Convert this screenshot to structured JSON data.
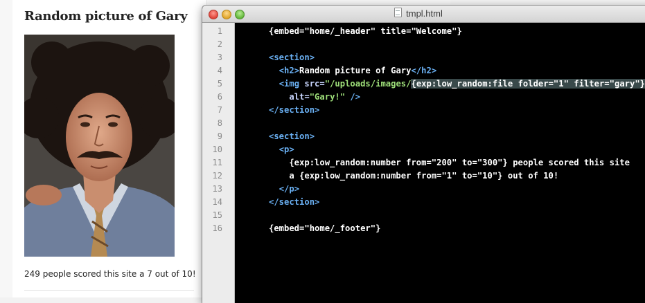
{
  "page": {
    "heading": "Random picture of Gary",
    "image_alt": "Gary!",
    "footer_text": "249 people scored this site a 7 out of 10!"
  },
  "editor": {
    "title": "tmpl.html",
    "line_numbers": [
      "1",
      "2",
      "3",
      "4",
      "5",
      "6",
      "7",
      "8",
      "9",
      "10",
      "11",
      "12",
      "13",
      "14",
      "15",
      "16"
    ],
    "lines": [
      {
        "parts": [
          {
            "t": "plain",
            "v": "{embed=\"home/_header\" title=\"Welcome\"}"
          }
        ]
      },
      {
        "parts": []
      },
      {
        "parts": [
          {
            "t": "tag",
            "v": "<section>"
          }
        ]
      },
      {
        "parts": [
          {
            "t": "plain",
            "v": "  "
          },
          {
            "t": "tag",
            "v": "<h2>"
          },
          {
            "t": "plain",
            "v": "Random picture of Gary"
          },
          {
            "t": "tag",
            "v": "</h2>"
          }
        ]
      },
      {
        "parts": [
          {
            "t": "plain",
            "v": "  "
          },
          {
            "t": "tag",
            "v": "<img "
          },
          {
            "t": "attr",
            "v": "src="
          },
          {
            "t": "str",
            "v": "\"/uploads/images/"
          },
          {
            "t": "hl",
            "v": "{exp:low_random:file folder=\"1\" filter=\"gary\"}"
          },
          {
            "t": "str",
            "v": "\""
          }
        ]
      },
      {
        "parts": [
          {
            "t": "plain",
            "v": "    "
          },
          {
            "t": "attr",
            "v": "alt="
          },
          {
            "t": "str",
            "v": "\"Gary!\""
          },
          {
            "t": "tag",
            "v": " />"
          }
        ]
      },
      {
        "parts": [
          {
            "t": "tag",
            "v": "</section>"
          }
        ]
      },
      {
        "parts": []
      },
      {
        "parts": [
          {
            "t": "tag",
            "v": "<section>"
          }
        ]
      },
      {
        "parts": [
          {
            "t": "plain",
            "v": "  "
          },
          {
            "t": "tag",
            "v": "<p>"
          }
        ]
      },
      {
        "parts": [
          {
            "t": "plain",
            "v": "    {exp:low_random:number from=\"200\" to=\"300\"} people scored this site"
          }
        ]
      },
      {
        "parts": [
          {
            "t": "plain",
            "v": "    a {exp:low_random:number from=\"1\" to=\"10\"} out of 10!"
          }
        ]
      },
      {
        "parts": [
          {
            "t": "plain",
            "v": "  "
          },
          {
            "t": "tag",
            "v": "</p>"
          }
        ]
      },
      {
        "parts": [
          {
            "t": "tag",
            "v": "</section>"
          }
        ]
      },
      {
        "parts": []
      },
      {
        "parts": [
          {
            "t": "plain",
            "v": "{embed=\"home/_footer\"}"
          }
        ]
      }
    ]
  },
  "colors": {
    "editor_bg": "#000000",
    "tag": "#6ab0f3",
    "string": "#9fe07a",
    "selection": "#39494a"
  }
}
